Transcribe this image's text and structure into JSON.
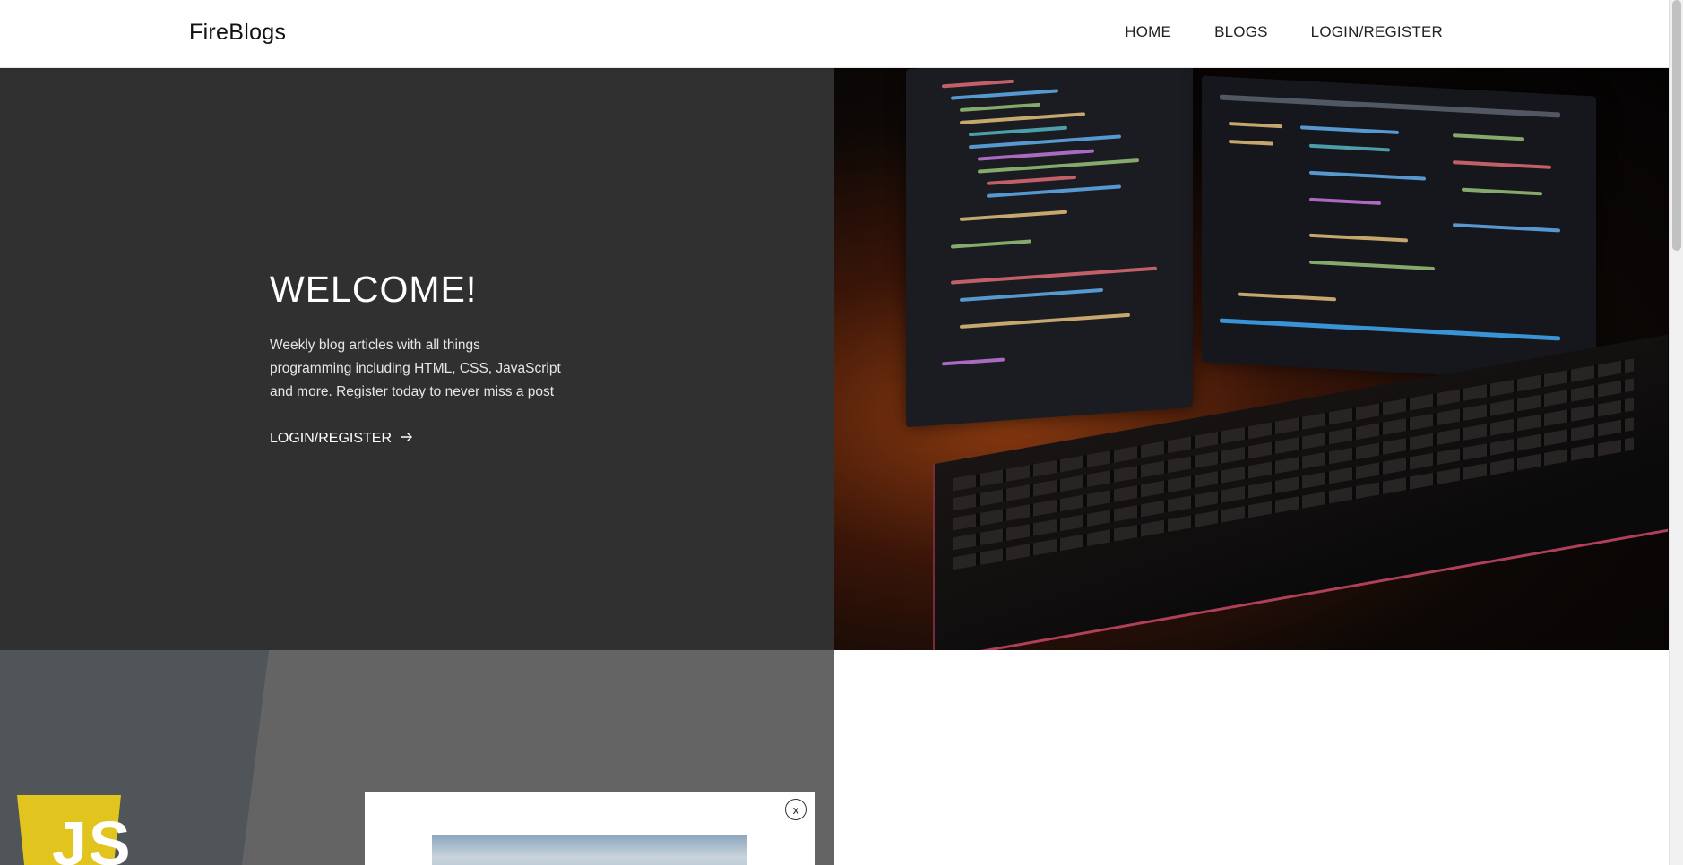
{
  "header": {
    "brand": "FireBlogs",
    "nav": [
      {
        "label": "HOME"
      },
      {
        "label": "BLOGS"
      },
      {
        "label": "LOGIN/REGISTER"
      }
    ]
  },
  "hero": {
    "title": "WELCOME!",
    "description": "Weekly blog articles with all things programming including HTML, CSS, JavaScript and more. Register today to never miss a post",
    "link_label": "LOGIN/REGISTER",
    "link_icon": "arrow-right-icon"
  },
  "lower": {
    "js_logo_text": "JS"
  },
  "modal": {
    "close_label": "x"
  },
  "colors": {
    "hero_bg": "#303030",
    "lower_bg": "#646464",
    "js_yellow": "#e1c41e"
  }
}
